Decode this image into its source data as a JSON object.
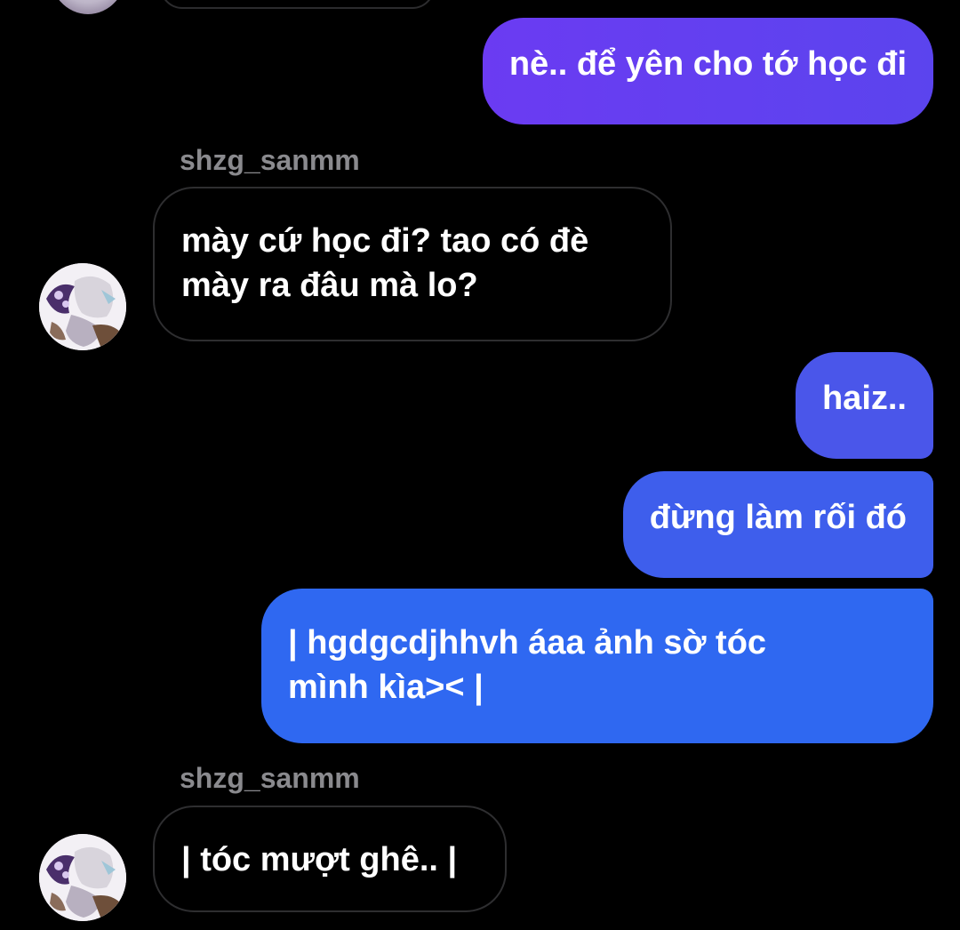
{
  "colors": {
    "background": "#000000",
    "incoming_border": "#2e2e30",
    "sender_name": "#8a8a8e",
    "out_gradient_top": "#6a3cf0",
    "out_gradient_mid": "#4a5ae8",
    "out_gradient_bottom": "#2f6bf2"
  },
  "messages": [
    {
      "id": "m1",
      "direction": "outgoing",
      "text": "nè.. để yên cho tớ học đi"
    },
    {
      "id": "m2",
      "direction": "incoming",
      "sender": "shzg_sanmm",
      "text": "mày cứ học đi? tao có đè\nmày ra đâu mà lo?",
      "avatar_icon": "profile-avatar-icon"
    },
    {
      "id": "m3",
      "direction": "outgoing",
      "text": "haiz.."
    },
    {
      "id": "m4",
      "direction": "outgoing",
      "text": "đừng làm rối đó"
    },
    {
      "id": "m5",
      "direction": "outgoing",
      "text": "| hgdgcdjhhvh áaa ảnh sờ tóc\nmình kìa>< |"
    },
    {
      "id": "m6",
      "direction": "incoming",
      "sender": "shzg_sanmm",
      "text": "| tóc mượt ghê.. |",
      "avatar_icon": "profile-avatar-icon"
    }
  ]
}
